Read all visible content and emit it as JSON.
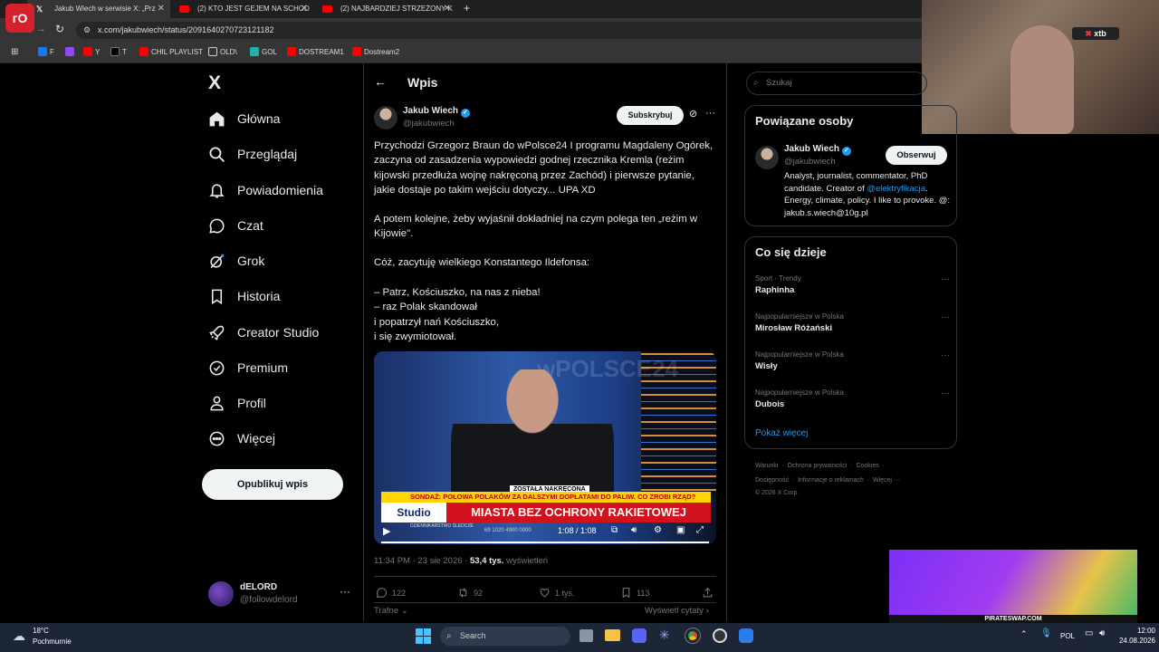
{
  "browser": {
    "tabs": [
      {
        "title": "Jakub Wiech w serwisie X: „Prz",
        "active": true
      },
      {
        "title": "(2) KTO JEST GEJEM NA SCHOD",
        "active": false
      },
      {
        "title": "(2) NAJBARDZIEJ STRZEŻONY K",
        "active": false
      }
    ],
    "url": "x.com/jakubwiech/status/2091640270723121182",
    "bookmarks": [
      "F",
      "",
      "Y",
      "T",
      "CHIL PLAYLIST",
      "OLD\\",
      "GOL",
      "DOSTREAM1",
      "Dostream2"
    ]
  },
  "stream_overlay": {
    "xtb_label": "xtb",
    "piratswap": "PIRATESWAP.COM"
  },
  "nav": {
    "logo": "X",
    "items": [
      {
        "label": "Główna",
        "icon": "home-icon"
      },
      {
        "label": "Przeglądaj",
        "icon": "search-icon"
      },
      {
        "label": "Powiadomienia",
        "icon": "bell-icon"
      },
      {
        "label": "Czat",
        "icon": "chat-icon"
      },
      {
        "label": "Grok",
        "icon": "grok-icon"
      },
      {
        "label": "Historia",
        "icon": "bookmark-icon"
      },
      {
        "label": "Creator Studio",
        "icon": "rocket-icon"
      },
      {
        "label": "Premium",
        "icon": "premium-icon"
      },
      {
        "label": "Profil",
        "icon": "user-icon"
      },
      {
        "label": "Więcej",
        "icon": "more-circle-icon"
      }
    ],
    "post_button": "Opublikuj wpis",
    "account": {
      "name": "dELORD",
      "handle": "@followdelord"
    }
  },
  "main": {
    "header": "Wpis",
    "author": {
      "name": "Jakub Wiech",
      "handle": "@jakubwiech"
    },
    "subscribe": "Subskrybuj",
    "paragraphs": [
      "Przychodzi Grzegorz Braun do wPolsce24 I programu Magdaleny Ogórek, zaczyna od zasadzenia wypowiedzi godnej rzecznika Kremla (reżim kijowski przedłuża wojnę nakręconą przez Zachód) i pierwsze pytanie, jakie dostaje po takim wejściu dotyczy... UPA XD",
      "A potem kolejne, żeby wyjaśnił dokładniej na czym polega ten „reżim w Kijowie\".",
      "Cóż, zacytuję wielkiego Konstantego Ildefonsa:",
      "– Patrz, Kościuszko, na nas z nieba!\n– raz Polak skandował\ni popatrzył nań Kościuszko,\ni się zwymiotował."
    ],
    "video": {
      "channel": "wPOLSCE24",
      "tag": "ZOSTAŁA NAKRĘCONA",
      "ticker": "SONDAŻ: POŁOWA POLAKÓW ZA DALSZYMI DOPŁATAMI DO PALIW. CO ZROBI RZĄD?",
      "headline": "MIASTA BEZ OCHRONY RAKIETOWEJ",
      "studio": "Studio",
      "time": "1:08 / 1:08",
      "bottom_text": "DZIENNIKARSTWO ŚLEDCZE",
      "num": "69 1020 4900 0000"
    },
    "meta": {
      "time": "11:34 PM · 23 sie 2026 · ",
      "views": "53,4 tys.",
      "views_label": " wyświetleń"
    },
    "stats": {
      "replies": "122",
      "reposts": "92",
      "likes": "1 tys.",
      "bookmarks": "113"
    },
    "sort": "Trafne",
    "quotes": "Wyświetl cytaty"
  },
  "right": {
    "search_placeholder": "Szukaj",
    "related_title": "Powiązane osoby",
    "related": {
      "name": "Jakub Wiech",
      "handle": "@jakubwiech",
      "follow": "Obserwuj",
      "bio_1": "Analyst, journalist, commentator, PhD candidate. Creator of ",
      "bio_link": "@elektryfikacja",
      "bio_2": ". Energy, climate, policy. I like to provoke. @: jakub.s.wiech@10g.pl"
    },
    "trends_title": "Co się dzieje",
    "trends": [
      {
        "meta": "Sport · Trendy",
        "name": "Raphinha"
      },
      {
        "meta": "Najpopularniejsze w Polska",
        "name": "Mirosław Różański"
      },
      {
        "meta": "Najpopularniejsze w Polska",
        "name": "Wisły"
      },
      {
        "meta": "Najpopularniejsze w Polska",
        "name": "Dubois"
      }
    ],
    "show_more": "Pokaż więcej",
    "footer_1": [
      "Warunki",
      "Ochrona prywatności",
      "Cookies"
    ],
    "footer_2": [
      "Dostępność",
      "Informacje o reklamach",
      "Więcej ···"
    ],
    "copyright": "© 2026 X Corp."
  },
  "taskbar": {
    "weather_temp": "18°C",
    "weather_desc": "Pochmurnie",
    "search": "Search",
    "lang": "POL",
    "time": "12:00",
    "date": "24.08.2026"
  }
}
